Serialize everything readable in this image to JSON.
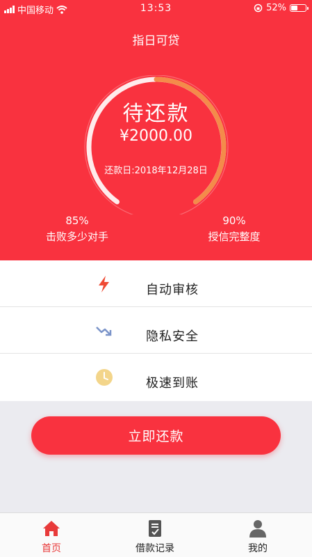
{
  "status_bar": {
    "carrier": "中国移动",
    "time": "13:53",
    "battery": "52%",
    "battery_level": 0.52
  },
  "header": {
    "title": "指日可贷"
  },
  "loan": {
    "status": "待还款",
    "amount": "¥2000.00",
    "due_date": "还款日:2018年12月28日"
  },
  "stats": {
    "left": {
      "value": "85%",
      "label": "击败多少对手"
    },
    "right": {
      "value": "90%",
      "label": "授信完整度"
    }
  },
  "features": [
    {
      "label": "自动审核",
      "icon": "lightning-icon"
    },
    {
      "label": "隐私安全",
      "icon": "trend-down-icon"
    },
    {
      "label": "极速到账",
      "icon": "clock-icon"
    }
  ],
  "actions": {
    "repay_label": "立即还款"
  },
  "tabbar": {
    "items": [
      {
        "label": "首页",
        "icon": "home-icon",
        "active": true
      },
      {
        "label": "借款记录",
        "icon": "document-icon",
        "active": false
      },
      {
        "label": "我的",
        "icon": "user-icon",
        "active": false
      }
    ]
  },
  "colors": {
    "primary": "#f9323f",
    "gauge_accent": "#f48b4a",
    "tab_active": "#e83a3a",
    "feature_accent": "#ef4b35"
  }
}
